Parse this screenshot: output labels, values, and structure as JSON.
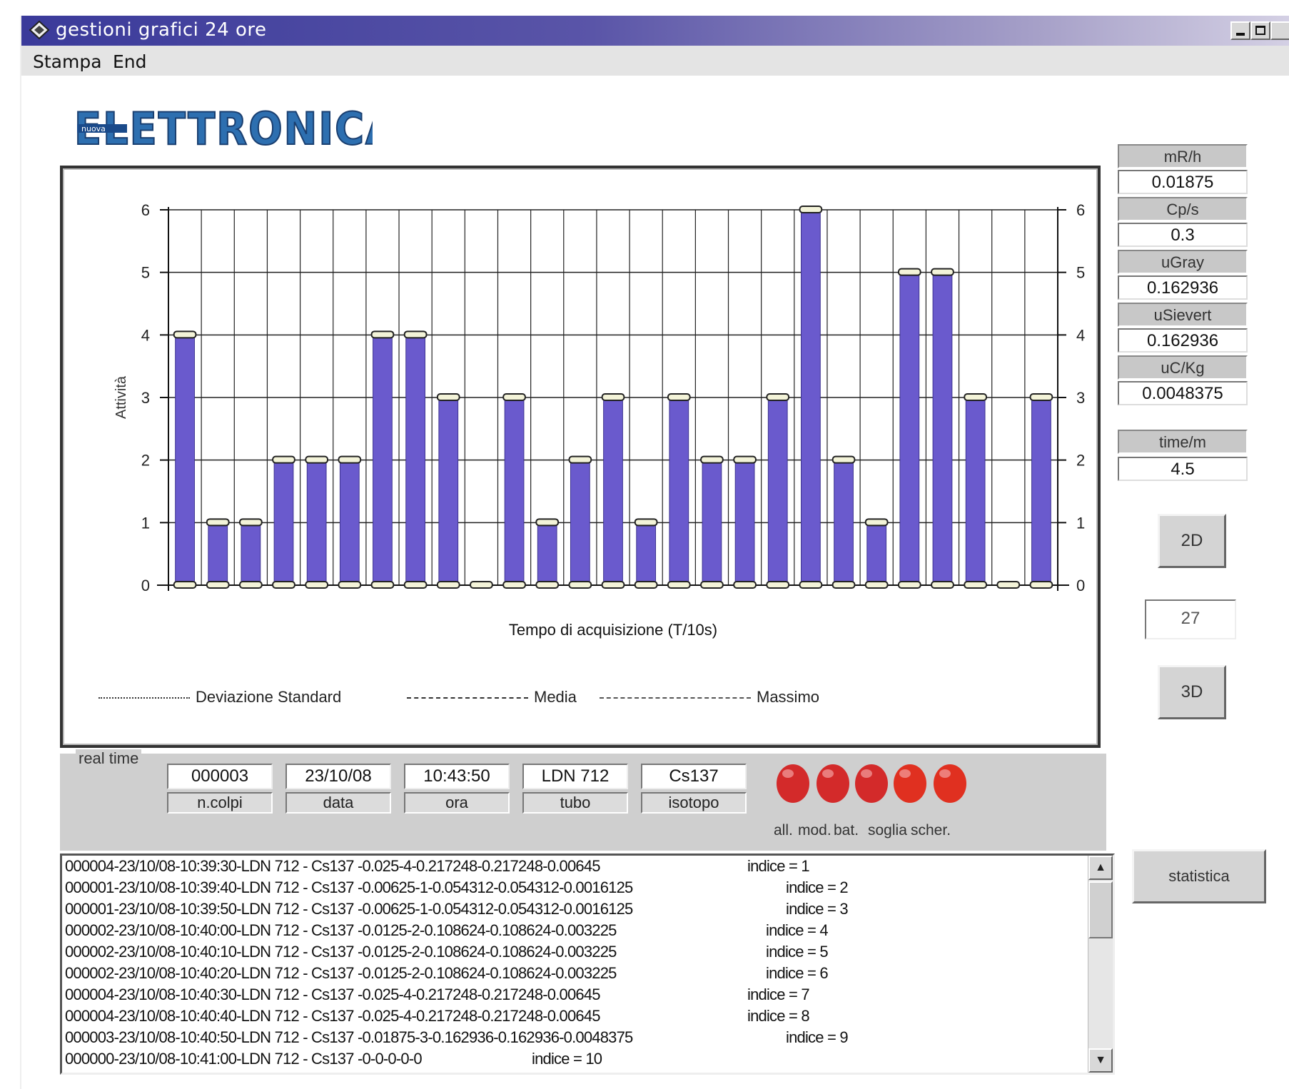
{
  "window": {
    "title": "gestioni grafici 24 ore",
    "menu": [
      "Stampa",
      "End"
    ]
  },
  "logo": {
    "text": "ELETTRONICA",
    "overlay": "nuova"
  },
  "chart_data": {
    "type": "bar",
    "title": "",
    "xlabel": "Tempo di  acquisizione (T/10s)",
    "ylabel": "Attività",
    "ylim": [
      0,
      6
    ],
    "yticks": [
      0,
      1,
      2,
      3,
      4,
      5,
      6
    ],
    "grid": true,
    "series": [
      {
        "values": [
          4,
          1,
          1,
          2,
          2,
          2,
          4,
          4,
          3,
          0,
          3,
          1,
          2,
          3,
          1,
          3,
          2,
          2,
          3,
          6,
          2,
          1,
          5,
          5,
          3,
          0,
          3
        ]
      }
    ],
    "legend": [
      {
        "label": "Deviazione Standard",
        "style": "dotted"
      },
      {
        "label": "Media",
        "style": "dashed"
      },
      {
        "label": "Massimo",
        "style": "dash-dot"
      }
    ],
    "bar_color": "#6a5acd"
  },
  "side_panel": {
    "items": [
      {
        "label": "mR/h",
        "value": "0.01875"
      },
      {
        "label": "Cp/s",
        "value": "0.3"
      },
      {
        "label": "uGray",
        "value": "0.162936"
      },
      {
        "label": "uSievert",
        "value": "0.162936"
      },
      {
        "label": "uC/Kg",
        "value": "0.0048375"
      }
    ],
    "time_label": "time/m",
    "time_value": "4.5",
    "btn_2d": "2D",
    "count": "27",
    "btn_3d": "3D",
    "statistica": "statistica"
  },
  "realtime": {
    "title": "real time",
    "fields": [
      {
        "value": "000003",
        "label": "n.colpi"
      },
      {
        "value": "23/10/08",
        "label": "data"
      },
      {
        "value": "10:43:50",
        "label": "ora"
      },
      {
        "value": "LDN 712",
        "label": "tubo"
      },
      {
        "value": "Cs137",
        "label": "isotopo"
      }
    ],
    "leds": [
      {
        "label": "all.",
        "color": "#d32a2a"
      },
      {
        "label": "mod.",
        "color": "#d32a2a"
      },
      {
        "label": "bat.",
        "color": "#d32a2a"
      },
      {
        "label": "soglia",
        "color": "#e03020"
      },
      {
        "label": "scher.",
        "color": "#e03020"
      }
    ]
  },
  "log": {
    "rows": [
      {
        "text": "000004-23/10/08-10:39:30-LDN 712 - Cs137 -0.025-4-0.217248-0.217248-0.00645",
        "index": "indice = 1"
      },
      {
        "text": "000001-23/10/08-10:39:40-LDN 712 - Cs137 -0.00625-1-0.054312-0.054312-0.0016125",
        "index": "indice = 2"
      },
      {
        "text": "000001-23/10/08-10:39:50-LDN 712 - Cs137 -0.00625-1-0.054312-0.054312-0.0016125",
        "index": "indice = 3"
      },
      {
        "text": "000002-23/10/08-10:40:00-LDN 712 - Cs137 -0.0125-2-0.108624-0.108624-0.003225",
        "index": "indice = 4"
      },
      {
        "text": "000002-23/10/08-10:40:10-LDN 712 - Cs137 -0.0125-2-0.108624-0.108624-0.003225",
        "index": "indice = 5"
      },
      {
        "text": "000002-23/10/08-10:40:20-LDN 712 - Cs137 -0.0125-2-0.108624-0.108624-0.003225",
        "index": "indice = 6"
      },
      {
        "text": "000004-23/10/08-10:40:30-LDN 712 - Cs137 -0.025-4-0.217248-0.217248-0.00645",
        "index": "indice = 7"
      },
      {
        "text": "000004-23/10/08-10:40:40-LDN 712 - Cs137 -0.025-4-0.217248-0.217248-0.00645",
        "index": "indice = 8"
      },
      {
        "text": "000003-23/10/08-10:40:50-LDN 712 - Cs137 -0.01875-3-0.162936-0.162936-0.0048375",
        "index": "indice = 9"
      },
      {
        "text": "000000-23/10/08-10:41:00-LDN 712 - Cs137 -0-0-0-0-0",
        "index": "indice = 10"
      }
    ]
  }
}
